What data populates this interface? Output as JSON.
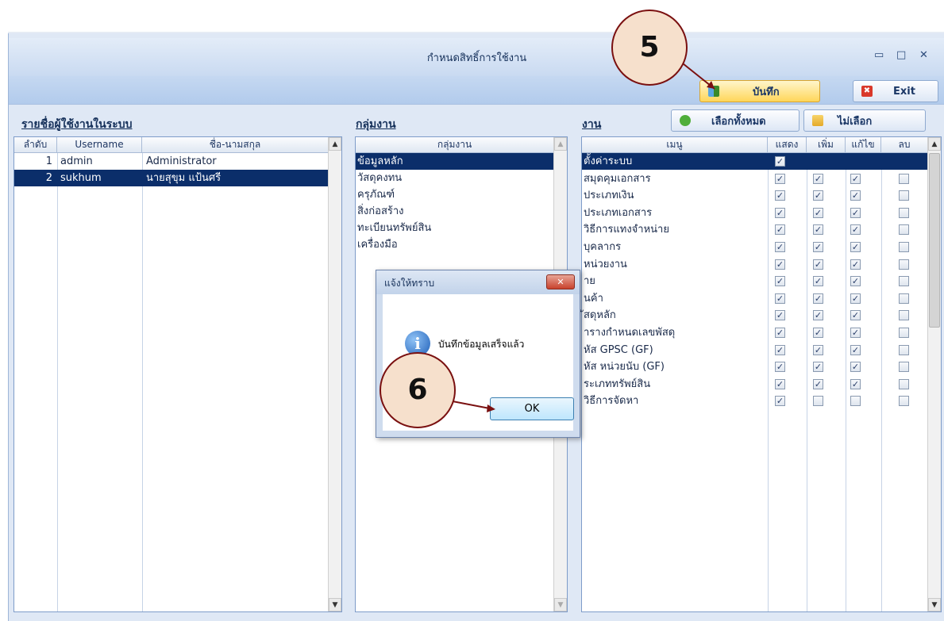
{
  "window": {
    "title": "กำหนดสิทธิ์การใช้งาน",
    "minimize": "▭",
    "restore": "□",
    "close": "✕"
  },
  "toolbar": {
    "save_label": "บันทึก",
    "exit_label": "Exit"
  },
  "users_panel": {
    "heading": "รายชื่อผู้ใช้งานในระบบ",
    "columns": [
      "ลำดับ",
      "Username",
      "ชื่อ-นามสกุล"
    ],
    "rows": [
      {
        "no": "1",
        "username": "admin",
        "fullname": "Administrator"
      },
      {
        "no": "2",
        "username": "sukhum",
        "fullname": "นายสุขุม  แป้นศรี"
      }
    ]
  },
  "groups_panel": {
    "heading": "กลุ่มงาน",
    "column": "กลุ่มงาน",
    "items": [
      "ข้อมูลหลัก",
      "วัสดุคงทน",
      "ครุภัณฑ์",
      "สิ่งก่อสร้าง",
      "ทะเบียนทรัพย์สิน",
      "เครื่องมือ"
    ]
  },
  "menu_panel": {
    "heading": "งาน",
    "select_all_label": "เลือกทั้งหมด",
    "select_none_label": "ไม่เลือก",
    "columns": [
      "เมนู",
      "แสดง",
      "เพิ่ม",
      "แก้ไข",
      "ลบ"
    ],
    "rows": [
      {
        "name": "ตั้งค่าระบบ",
        "show": true
      },
      {
        "name": "สมุดคุมเอกสาร",
        "show": true,
        "add": true,
        "edit": true,
        "delete": false
      },
      {
        "name": "ประเภทเงิน",
        "show": true,
        "add": true,
        "edit": true,
        "delete": false
      },
      {
        "name": "ประเภทเอกสาร",
        "show": true,
        "add": true,
        "edit": true,
        "delete": false
      },
      {
        "name": "วิธีการแทงจำหน่าย",
        "show": true,
        "add": true,
        "edit": true,
        "delete": false
      },
      {
        "name": "บุคลากร",
        "show": true,
        "add": true,
        "edit": true,
        "delete": false
      },
      {
        "name": "หน่วยงาน",
        "show": true,
        "add": true,
        "edit": true,
        "delete": false
      },
      {
        "name": "าย",
        "show": true,
        "add": true,
        "edit": true,
        "delete": false
      },
      {
        "name": "นค้า",
        "show": true,
        "add": true,
        "edit": true,
        "delete": false
      },
      {
        "name": "ัสดุหลัก",
        "show": true,
        "add": true,
        "edit": true,
        "delete": false
      },
      {
        "name": "ารางกำหนดเลขพัสดุ",
        "show": true,
        "add": true,
        "edit": true,
        "delete": false
      },
      {
        "name": "หัส GPSC (GF)",
        "show": true,
        "add": true,
        "edit": true,
        "delete": false
      },
      {
        "name": "หัส หน่วยนับ (GF)",
        "show": true,
        "add": true,
        "edit": true,
        "delete": false
      },
      {
        "name": "ระเภททรัพย์สิน",
        "show": true,
        "add": true,
        "edit": true,
        "delete": false
      },
      {
        "name": "วิธีการจัดหา",
        "show": true,
        "add": false,
        "edit": false,
        "delete": false
      }
    ]
  },
  "dialog": {
    "title": "แจ้งให้ทราบ",
    "message": "บันทึกข้อมูลเสร็จแล้ว",
    "ok_label": "OK",
    "close": "✕",
    "info_glyph": "i"
  },
  "callouts": {
    "step5": "5",
    "step6": "6"
  },
  "colors": {
    "selection": "#0b2e6a",
    "save_button": "#ffd65a",
    "callout_fill": "#f6e0cc"
  }
}
